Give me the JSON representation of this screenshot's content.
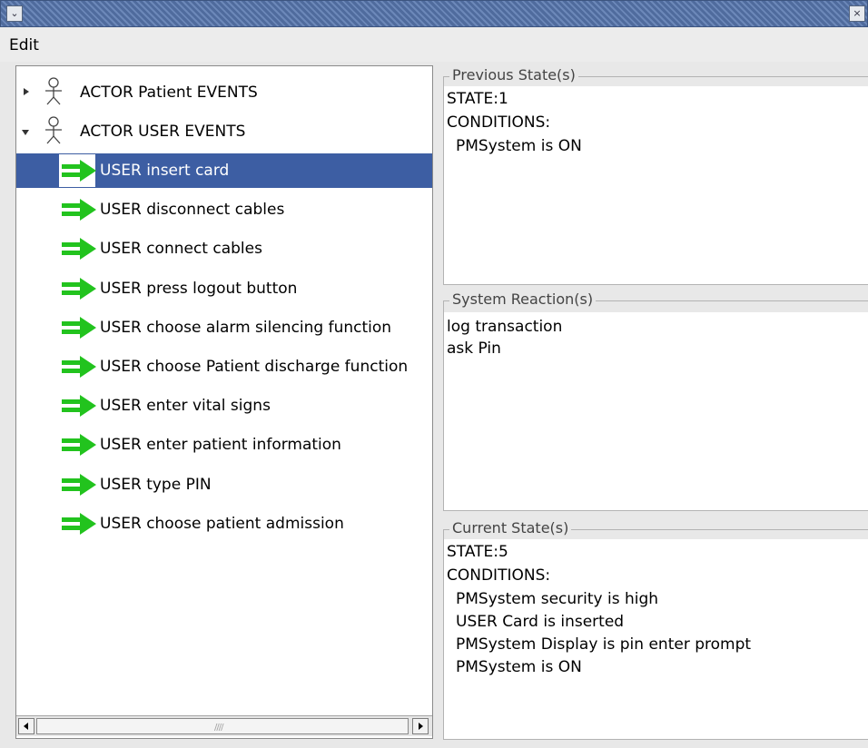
{
  "window": {
    "menu_button_glyph": "⌄",
    "close_button_glyph": "×"
  },
  "menubar": {
    "edit_label": "Edit"
  },
  "tree": {
    "actors": [
      {
        "label": "ACTOR Patient EVENTS",
        "expanded": false,
        "icon": "actor-icon"
      },
      {
        "label": "ACTOR USER EVENTS",
        "expanded": true,
        "icon": "actor-icon"
      }
    ],
    "events": [
      {
        "label": "USER insert card",
        "selected": true,
        "icon": "arrow-icon"
      },
      {
        "label": "USER disconnect cables",
        "icon": "arrow-icon"
      },
      {
        "label": "USER connect cables",
        "icon": "arrow-icon"
      },
      {
        "label": "USER press logout button",
        "icon": "arrow-icon"
      },
      {
        "label": "USER choose alarm silencing function",
        "icon": "arrow-icon"
      },
      {
        "label": "USER choose Patient discharge function",
        "icon": "arrow-icon"
      },
      {
        "label": "USER enter vital signs",
        "icon": "arrow-icon"
      },
      {
        "label": "USER enter patient information",
        "icon": "arrow-icon"
      },
      {
        "label": "USER type PIN",
        "icon": "arrow-icon"
      },
      {
        "label": "USER choose patient admission",
        "icon": "arrow-icon"
      }
    ],
    "scrollbar_grip": "////"
  },
  "previous_state": {
    "title": "Previous State(s)",
    "state": "STATE:1",
    "conditions_label": "CONDITIONS:",
    "conditions": [
      "PMSystem is ON"
    ]
  },
  "system_reaction": {
    "title": "System Reaction(s)",
    "lines": [
      "log transaction",
      "ask Pin"
    ]
  },
  "current_state": {
    "title": "Current State(s)",
    "state": "STATE:5",
    "conditions_label": "CONDITIONS:",
    "conditions": [
      "PMSystem security is high",
      "USER Card is inserted",
      "PMSystem Display is pin enter prompt",
      "PMSystem is ON"
    ]
  },
  "colors": {
    "selection": "#3d5ea3",
    "arrow_green": "#22c31e",
    "titlebar": "#5a77a8"
  }
}
